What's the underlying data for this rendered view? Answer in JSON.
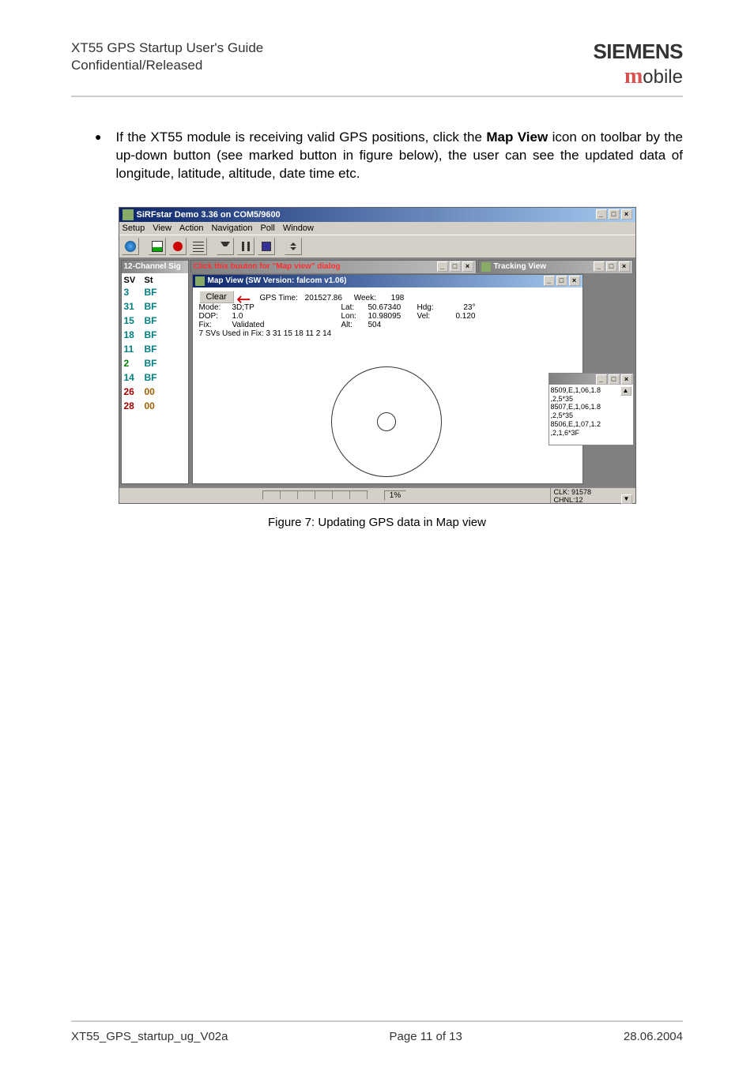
{
  "header": {
    "doc_title": "XT55 GPS Startup User's Guide",
    "classification": "Confidential/Released",
    "brand": "SIEMENS",
    "brand_sub_m": "m",
    "brand_sub_rest": "obile"
  },
  "body": {
    "bullet_text": "If the XT55 module is receiving valid GPS positions, click the Map View icon on toolbar by the up-down button (see marked button in figure below), the user can see the updated data of longitude, latitude, altitude, date time etc.",
    "bold_phrase": "Map View"
  },
  "app": {
    "title": "SiRFstar Demo 3.36 on COM5/9600",
    "menu": [
      "Setup",
      "View",
      "Action",
      "Navigation",
      "Poll",
      "Window"
    ],
    "channel_title": "12-Channel Sig",
    "annotation_text": "Click this buuton for \"Map view\" dialog",
    "tracking_title": "Tracking View",
    "mapview_title": "Map View (SW Version: falcom v1.06)",
    "clear_label": "Clear",
    "channel_header": {
      "sv": "SV",
      "st": "St"
    },
    "channels": [
      {
        "sv": "3",
        "st": "BF",
        "sv_cls": "sv-teal",
        "st_cls": "st-bf"
      },
      {
        "sv": "31",
        "st": "BF",
        "sv_cls": "sv-teal",
        "st_cls": "st-bf"
      },
      {
        "sv": "15",
        "st": "BF",
        "sv_cls": "sv-teal",
        "st_cls": "st-bf"
      },
      {
        "sv": "18",
        "st": "BF",
        "sv_cls": "sv-teal",
        "st_cls": "st-bf"
      },
      {
        "sv": "11",
        "st": "BF",
        "sv_cls": "sv-teal",
        "st_cls": "st-bf"
      },
      {
        "sv": "2",
        "st": "BF",
        "sv_cls": "sv-green",
        "st_cls": "st-bf"
      },
      {
        "sv": "14",
        "st": "BF",
        "sv_cls": "sv-teal",
        "st_cls": "st-bf"
      },
      {
        "sv": "26",
        "st": "00",
        "sv_cls": "sv-red",
        "st_cls": "st-00"
      },
      {
        "sv": "28",
        "st": "00",
        "sv_cls": "sv-red",
        "st_cls": "st-00"
      }
    ],
    "gps": {
      "gps_time_label": "GPS Time:",
      "gps_time_val": "201527.86",
      "week_label": "Week:",
      "week_val": "198",
      "mode_label": "Mode:",
      "mode_val": "3D;TP",
      "lat_label": "Lat:",
      "lat_val": "50.67340",
      "hdg_label": "Hdg:",
      "hdg_val": "23°",
      "dop_label": "DOP:",
      "dop_val": "1.0",
      "lon_label": "Lon:",
      "lon_val": "10.98095",
      "vel_label": "Vel:",
      "vel_val": "0.120",
      "fix_label": "Fix:",
      "fix_val": "Validated",
      "alt_label": "Alt:",
      "alt_val": "504",
      "svs_used": "7  SVs Used in Fix:  3 31 15 18 11 2 14"
    },
    "side_lines": [
      "8509,E,1,06,1.8",
      ",2,5*35",
      "8507,E,1,06,1.8",
      ",2,5*35",
      "8506,E,1,07,1.2",
      ",2,1,6*3F"
    ],
    "status": {
      "pct": "1%",
      "clk": "CLK: 91578",
      "chnl": "CHNL:12"
    }
  },
  "figure_caption": "Figure 7: Updating GPS data in Map view",
  "footer": {
    "left": "XT55_GPS_startup_ug_V02a",
    "center": "Page 11 of 13",
    "right": "28.06.2004"
  }
}
